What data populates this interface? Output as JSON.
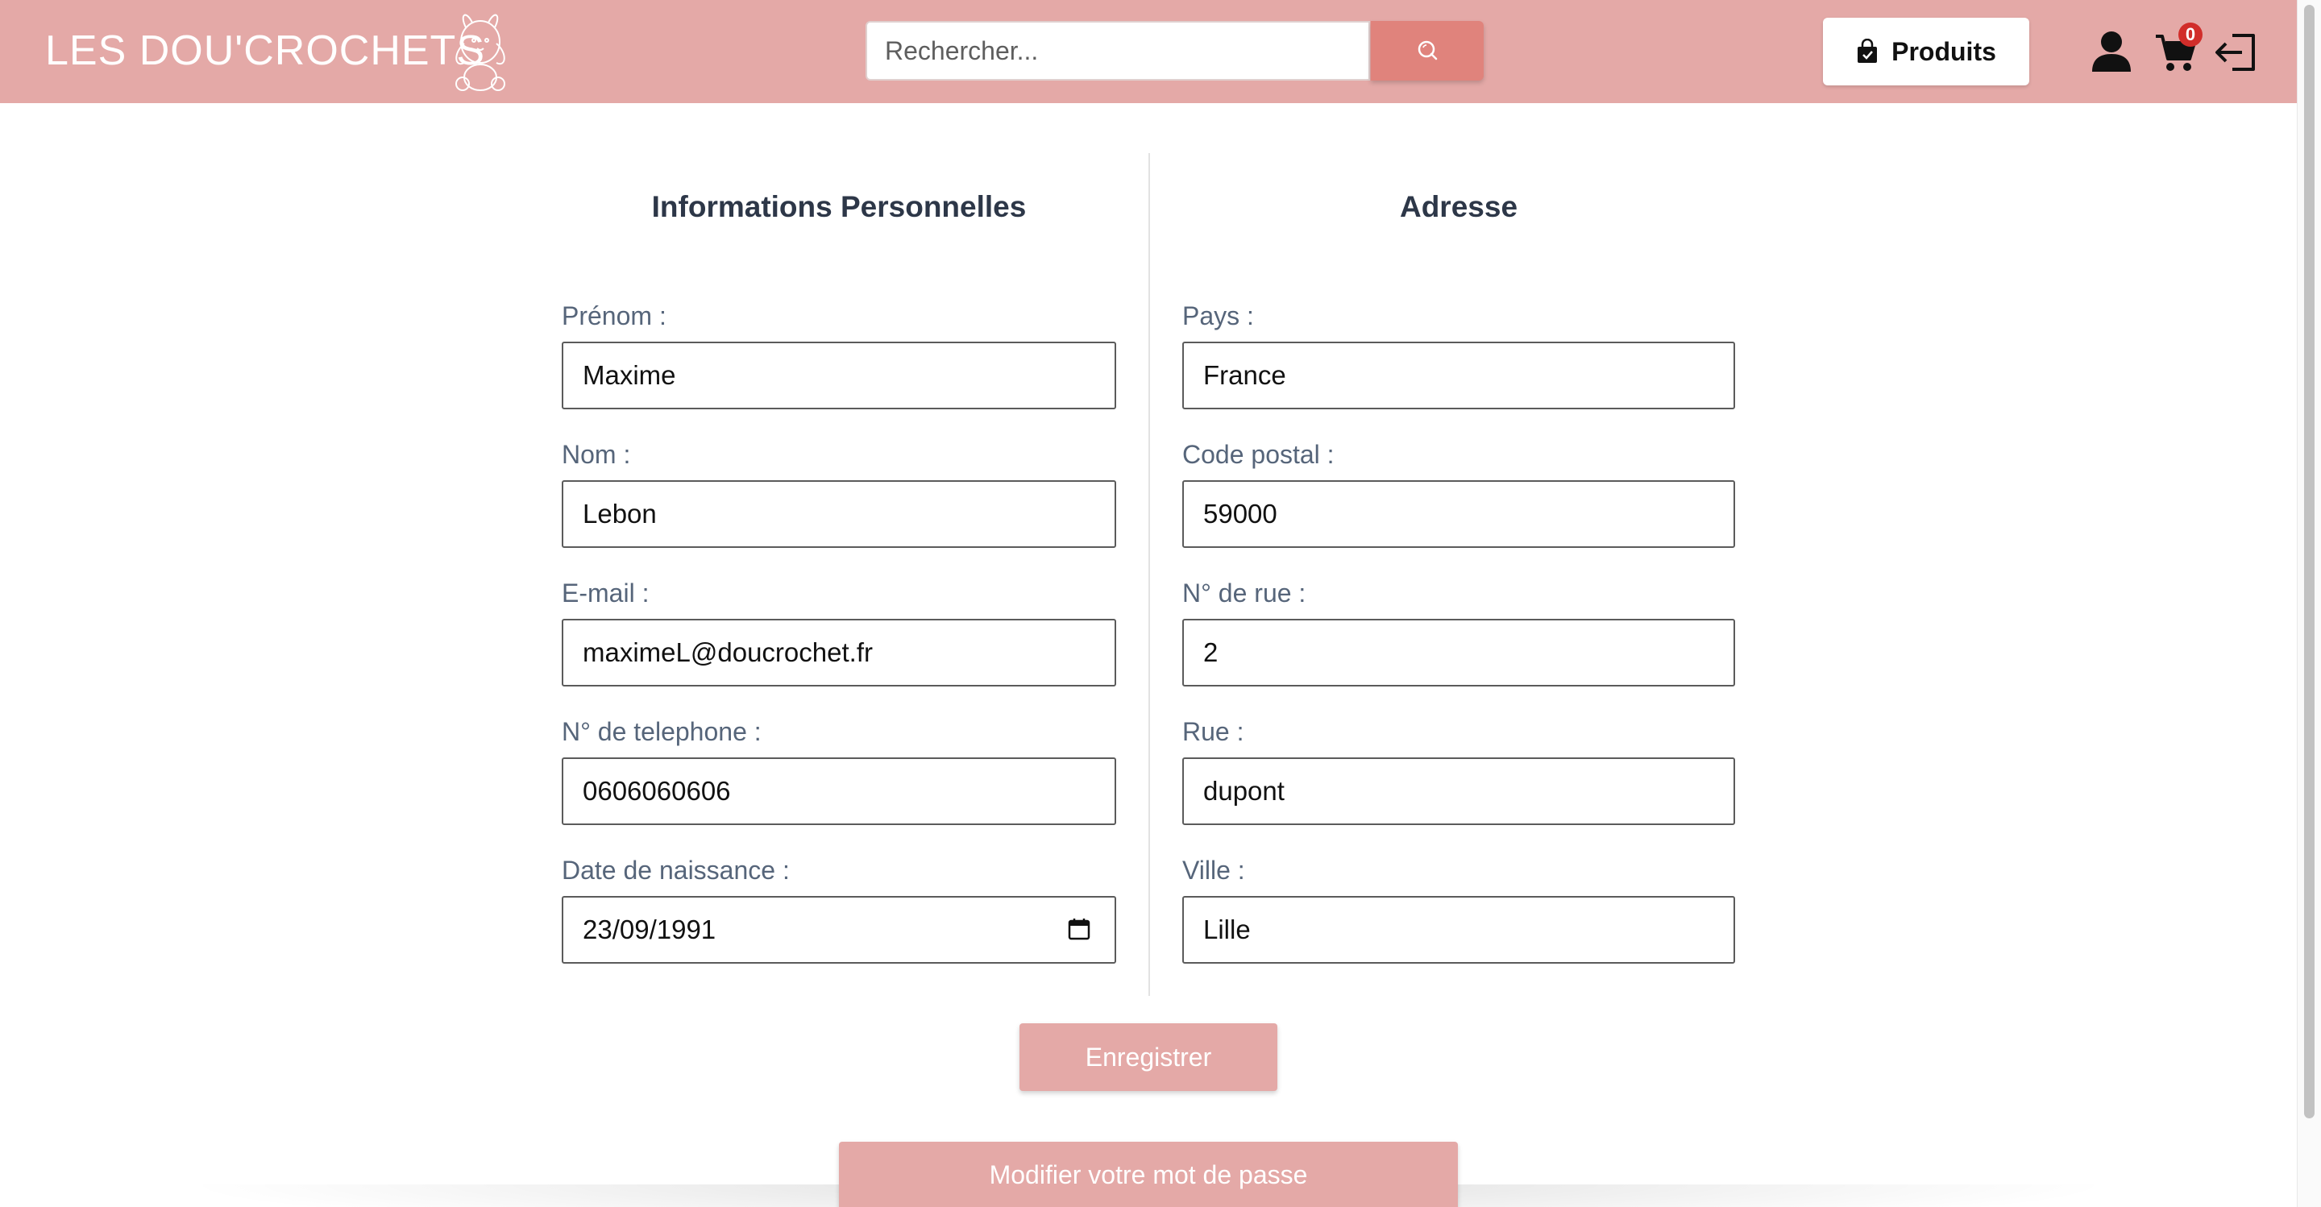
{
  "header": {
    "logo_text": "LES DOU'CROCHETS",
    "search_placeholder": "Rechercher...",
    "products_label": "Produits",
    "cart_count": "0"
  },
  "colors": {
    "header_bg": "#e4a9a7",
    "search_button": "#e0837c",
    "primary_button": "#e4a9a7",
    "badge": "#d12d2a"
  },
  "icons": {
    "search": "search-icon",
    "products": "shopping-bag-icon",
    "user": "user-icon",
    "cart": "cart-icon",
    "logout": "logout-icon",
    "date": "calendar-icon"
  },
  "personal": {
    "title": "Informations Personnelles",
    "fields": [
      {
        "label": "Prénom :",
        "value": "Maxime"
      },
      {
        "label": "Nom :",
        "value": "Lebon"
      },
      {
        "label": "E-mail :",
        "value": "maximeL@doucrochet.fr"
      },
      {
        "label": "N° de telephone :",
        "value": "0606060606"
      },
      {
        "label": "Date de naissance :",
        "value": "23/09/1991"
      }
    ]
  },
  "address": {
    "title": "Adresse",
    "fields": [
      {
        "label": "Pays :",
        "value": "France"
      },
      {
        "label": "Code postal :",
        "value": "59000"
      },
      {
        "label": "N° de rue :",
        "value": "2"
      },
      {
        "label": "Rue :",
        "value": "dupont"
      },
      {
        "label": "Ville :",
        "value": "Lille"
      }
    ]
  },
  "actions": {
    "save_label": "Enregistrer",
    "change_password_label": "Modifier votre mot de passe"
  }
}
